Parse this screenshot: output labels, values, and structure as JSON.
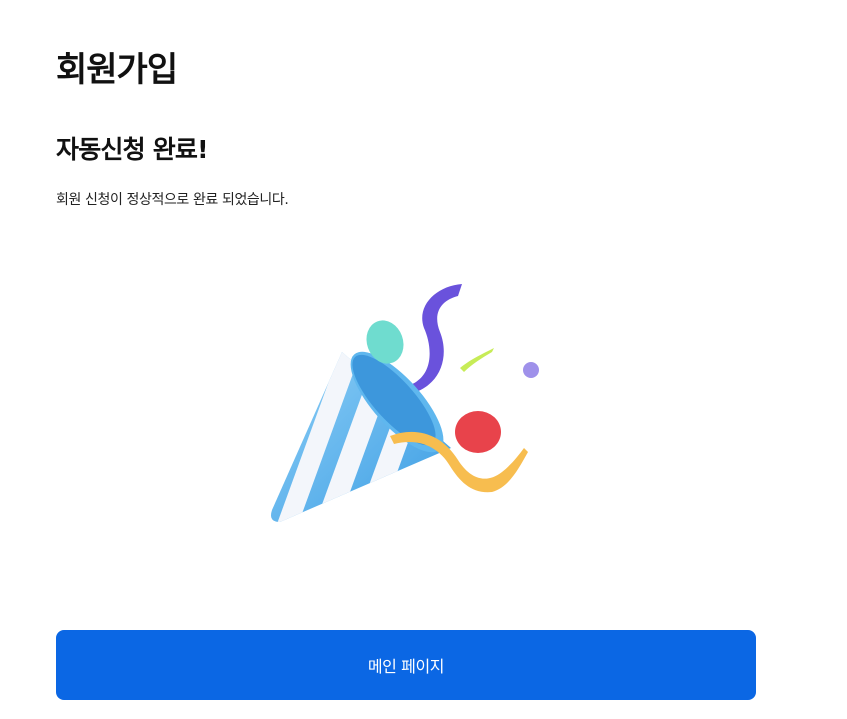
{
  "page": {
    "title": "회원가입",
    "heading": "자동신청 완료!",
    "description": "회원 신청이 정상적으로 완료 되었습니다."
  },
  "illustration": {
    "icon": "party-popper-icon"
  },
  "actions": {
    "main_page_label": "메인 페이지"
  },
  "colors": {
    "primary_button": "#0b67e4",
    "title_text": "#111111"
  }
}
